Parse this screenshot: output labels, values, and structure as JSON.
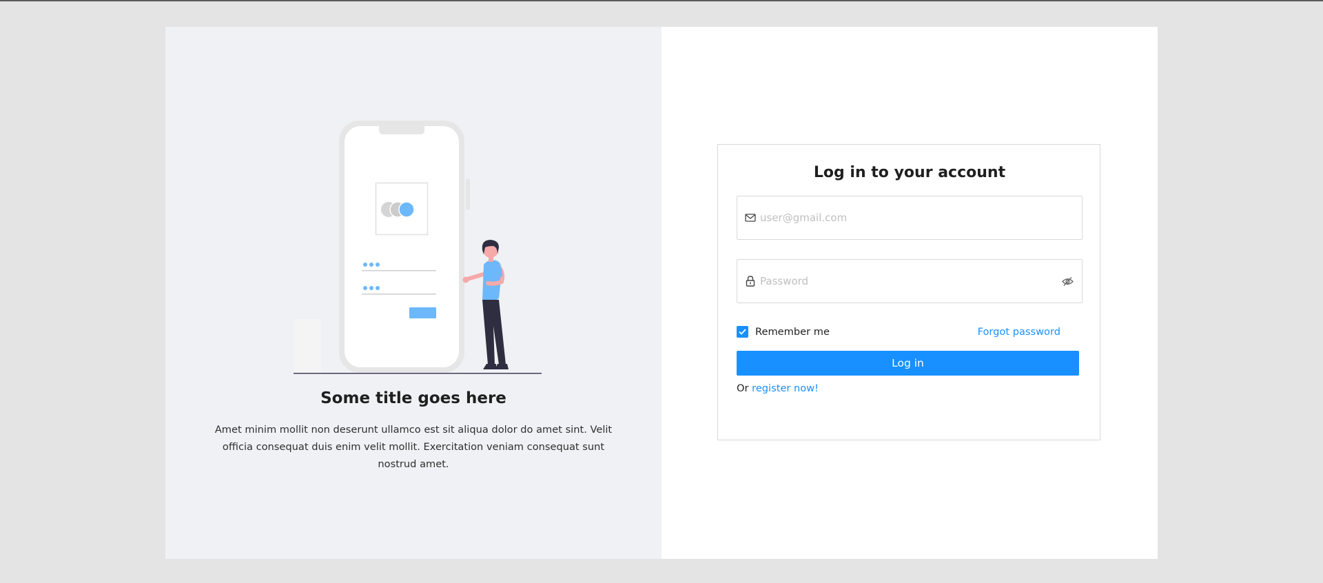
{
  "promo": {
    "title": "Some title goes here",
    "description": "Amet minim mollit non deserunt ullamco est sit aliqua dolor do amet sint. Velit officia consequat duis enim velit mollit. Exercitation veniam consequat sunt nostrud amet."
  },
  "login": {
    "title": "Log in to your account",
    "email_placeholder": "user@gmail.com",
    "password_placeholder": "Password",
    "remember_label": "Remember me",
    "remember_checked": true,
    "forgot_label": "Forgot password",
    "submit_label": "Log in",
    "register_prefix": "Or",
    "register_link": "register now!"
  },
  "icons": {
    "email": "mail-icon",
    "password": "lock-icon",
    "visibility": "eye-invisible-icon",
    "checkbox": "check-icon"
  },
  "colors": {
    "page_background": "#e4e4e4",
    "left_panel": "#f0f1f4",
    "right_panel": "#ffffff",
    "accent": "#1890ff",
    "illustration_accent": "#6cb8fa"
  }
}
